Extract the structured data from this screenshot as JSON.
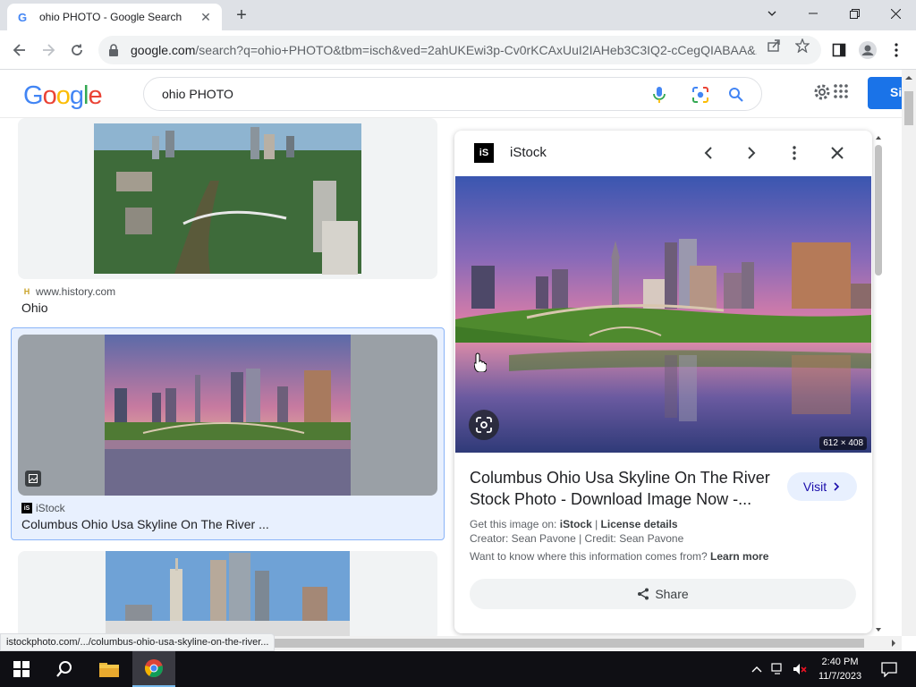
{
  "browser": {
    "tab_title": "ohio PHOTO - Google Search",
    "url_host": "google.com",
    "url_rest": "/search?q=ohio+PHOTO&tbm=isch&ved=2ahUKEwi3p-Cv0rKCAxUuI2IAHeb3C3IQ2-cCegQIABAA&...",
    "status_url": "istockphoto.com/.../columbus-ohio-usa-skyline-on-the-river..."
  },
  "search": {
    "query": "ohio PHOTO",
    "signin_label": "Si"
  },
  "results": [
    {
      "source": "www.history.com",
      "title": "Ohio"
    },
    {
      "source": "iStock",
      "title": "Columbus Ohio Usa Skyline On The River ..."
    }
  ],
  "panel": {
    "source_name": "iStock",
    "logo_text": "iS",
    "dimensions": "612 × 408",
    "title": "Columbus Ohio Usa Skyline On The River Stock Photo - Download Image Now -...",
    "visit_label": "Visit",
    "get_image_label": "Get this image on:",
    "get_image_source": "iStock",
    "license_label": "License details",
    "creator_line": "Creator: Sean Pavone | Credit: Sean Pavone",
    "want_to_know": "Want to know where this information comes from?",
    "learn_more": "Learn more",
    "share_label": "Share"
  },
  "taskbar": {
    "time": "2:40 PM",
    "date": "11/7/2023"
  },
  "colors": {
    "accent": "#1a73e8",
    "google_blue": "#4285f4",
    "google_red": "#ea4335",
    "google_yellow": "#fbbc05",
    "google_green": "#34a853"
  }
}
